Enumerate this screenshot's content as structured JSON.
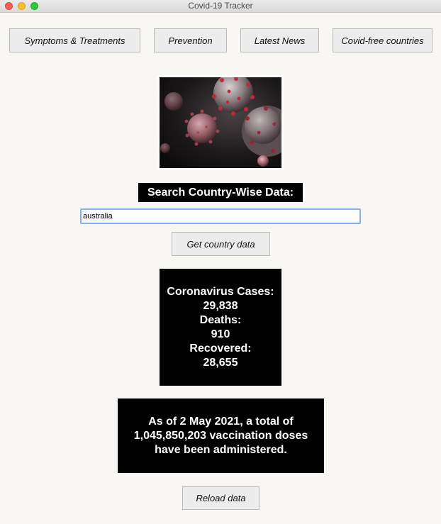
{
  "window": {
    "title": "Covid-19 Tracker"
  },
  "nav": {
    "symptoms": "Symptoms & Treatments",
    "prevention": "Prevention",
    "news": "Latest News",
    "covid_free": "Covid-free countries"
  },
  "search": {
    "label": "Search Country-Wise Data:",
    "value": "australia",
    "button": "Get country data"
  },
  "stats": {
    "cases_label": "Coronavirus Cases:",
    "cases": "29,838",
    "deaths_label": "Deaths:",
    "deaths": "910",
    "recovered_label": "Recovered:",
    "recovered": "28,655"
  },
  "vaccination": {
    "text": "As of 2 May 2021, a total of 1,045,850,203 vaccination doses have been administered."
  },
  "reload": {
    "label": "Reload data"
  }
}
